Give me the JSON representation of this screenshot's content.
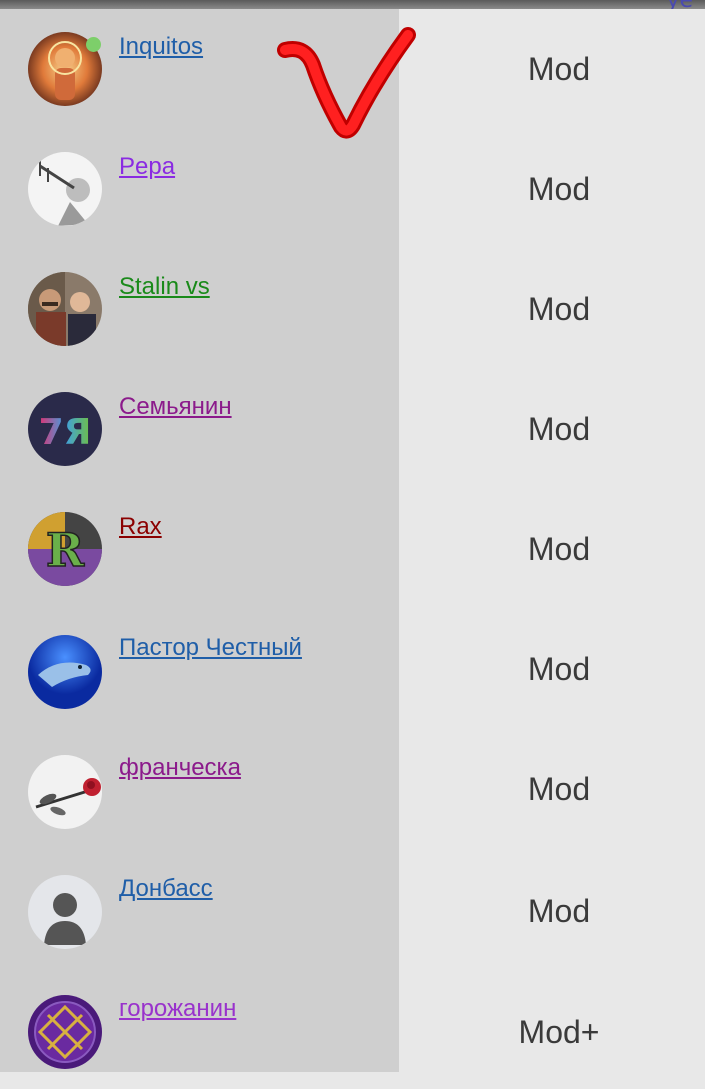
{
  "users": [
    {
      "name": "Inquitos",
      "color": "#1f5ea8",
      "role": "Mod",
      "avatar": "inquitos-avatar",
      "online": true
    },
    {
      "name": "Pepa",
      "color": "#8a2be2",
      "role": "Mod",
      "avatar": "trumpeter-avatar",
      "online": false
    },
    {
      "name": "Stalin vs",
      "color": "#1a8a1a",
      "role": "Mod",
      "avatar": "stalin-putin-avatar",
      "online": false
    },
    {
      "name": "Семьянин",
      "color": "#8b1a8b",
      "role": "Mod",
      "avatar": "7ya-logo-avatar",
      "online": false
    },
    {
      "name": "Rax",
      "color": "#8b0000",
      "role": "Mod",
      "avatar": "r-logo-avatar",
      "online": false
    },
    {
      "name": "Пастор Честный",
      "color": "#1f5ea8",
      "role": "Mod",
      "avatar": "dolphin-avatar",
      "online": false
    },
    {
      "name": "франческа",
      "color": "#8b1a8b",
      "role": "Mod",
      "avatar": "rose-avatar",
      "online": false
    },
    {
      "name": "Донбасс",
      "color": "#1f5ea8",
      "role": "Mod",
      "avatar": "default-person-avatar",
      "online": false
    },
    {
      "name": "горожанин",
      "color": "#9932cc",
      "role": "Mod+",
      "avatar": "purple-emblem-avatar",
      "online": false
    }
  ],
  "annotation": {
    "mark": "red-checkmark",
    "color": "#e01010"
  }
}
